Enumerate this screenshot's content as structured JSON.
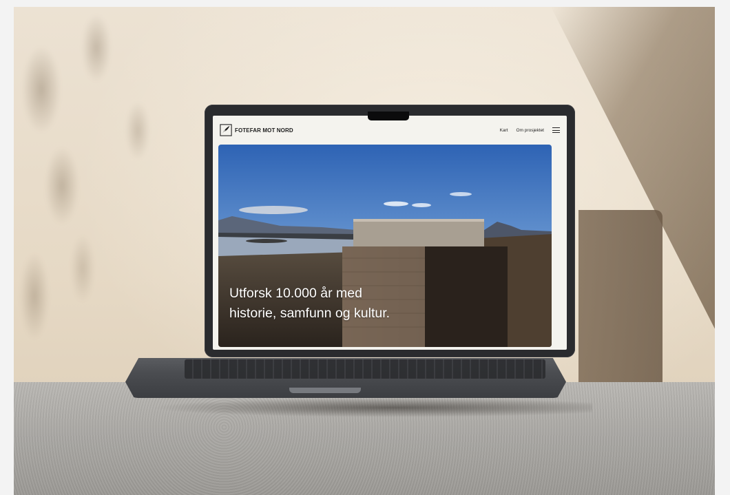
{
  "site": {
    "brand_name": "FOTEFAR MOT NORD",
    "nav": {
      "kart_label": "Kart",
      "om_label": "Om prosjektet"
    },
    "menu_icon": "hamburger-menu-icon",
    "hero": {
      "line1": "Utforsk 10.000 år med",
      "line2": "historie, samfunn og kultur."
    }
  },
  "colors": {
    "screen_background": "#f4f3ee",
    "hero_text": "#ffffff",
    "laptop_body": "#2a2b2e"
  }
}
